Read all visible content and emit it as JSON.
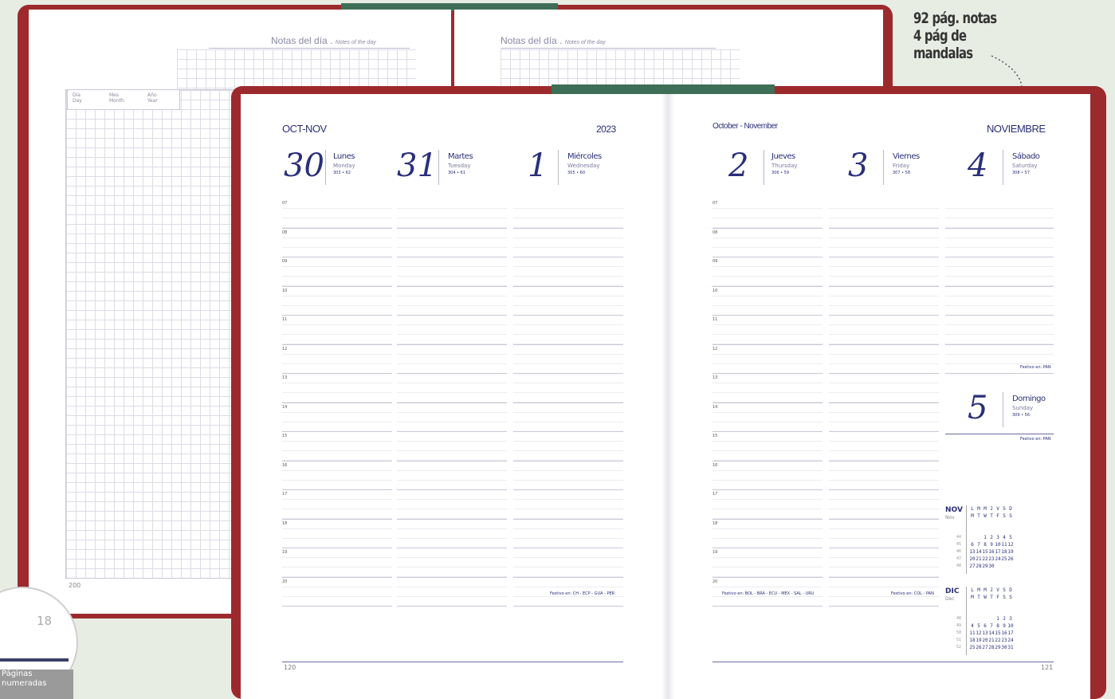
{
  "annotation": {
    "lines": [
      "92 pág. notas",
      "4 pág de",
      "mandalas"
    ]
  },
  "back_book": {
    "notes_title": "Notas del día .",
    "notes_subtitle": "Notes of the day",
    "date_fields": [
      "Día",
      "Mes",
      "Año"
    ],
    "date_fields_en": [
      "Day",
      "Month",
      "Year"
    ],
    "page_number": "200"
  },
  "badge": {
    "number": "18",
    "text_lines": [
      "Páginas",
      "numeradas"
    ]
  },
  "left_page": {
    "month_label": "OCT-NOV",
    "year": "2023",
    "days": [
      {
        "num": "30",
        "name": "Lunes",
        "eng": "Monday",
        "count": "303 • 62"
      },
      {
        "num": "31",
        "name": "Martes",
        "eng": "Tuesday",
        "count": "304 • 61"
      },
      {
        "num": "1",
        "name": "Miércoles",
        "eng": "Wednesday",
        "count": "305 • 60"
      }
    ],
    "hours": [
      "07",
      "08",
      "09",
      "10",
      "11",
      "12",
      "13",
      "14",
      "15",
      "16",
      "17",
      "18",
      "19",
      "20"
    ],
    "holidays": "Festivo en: CH - ECP - GUA - PER",
    "page_number": "120"
  },
  "right_page": {
    "month_label": "October - November",
    "month_title": "NOVIEMBRE",
    "days": [
      {
        "num": "2",
        "name": "Jueves",
        "eng": "Thursday",
        "count": "306 • 59"
      },
      {
        "num": "3",
        "name": "Viernes",
        "eng": "Friday",
        "count": "307 • 58"
      },
      {
        "num": "4",
        "name": "Sábado",
        "eng": "Saturday",
        "count": "308 • 57"
      }
    ],
    "sunday": {
      "num": "5",
      "name": "Domingo",
      "eng": "Sunday",
      "count": "309 • 56"
    },
    "hours": [
      "07",
      "08",
      "09",
      "10",
      "11",
      "12",
      "13",
      "14",
      "15",
      "16",
      "17",
      "18",
      "19",
      "20"
    ],
    "holiday_saturday": "Festivo en: PAN",
    "holiday_sunday": "Festivo en: PAN",
    "holidays_left": "Festivo en: BOL - BRA - ECU - MEX - SAL - URU",
    "holidays_right": "Festivo en: COL - PAN",
    "page_number": "121",
    "mini_cals": [
      {
        "month": "NOV",
        "month_en": "Nov",
        "head1": [
          "L",
          "M",
          "M",
          "J",
          "V",
          "S",
          "D"
        ],
        "head2": [
          "M",
          "T",
          "W",
          "T",
          "F",
          "S",
          "S"
        ],
        "rows": [
          [
            "",
            "",
            "1",
            "2",
            "3",
            "4",
            "5"
          ],
          [
            "6",
            "7",
            "8",
            "9",
            "10",
            "11",
            "12"
          ],
          [
            "13",
            "14",
            "15",
            "16",
            "17",
            "18",
            "19"
          ],
          [
            "20",
            "21",
            "22",
            "23",
            "24",
            "25",
            "26"
          ],
          [
            "27",
            "28",
            "29",
            "30",
            "",
            "",
            ""
          ]
        ],
        "weeks": [
          "44",
          "45",
          "46",
          "47",
          "48"
        ]
      },
      {
        "month": "DIC",
        "month_en": "Dec",
        "head1": [
          "L",
          "M",
          "M",
          "J",
          "V",
          "S",
          "D"
        ],
        "head2": [
          "M",
          "T",
          "W",
          "T",
          "F",
          "S",
          "S"
        ],
        "rows": [
          [
            "",
            "",
            "",
            "",
            "1",
            "2",
            "3"
          ],
          [
            "4",
            "5",
            "6",
            "7",
            "8",
            "9",
            "10"
          ],
          [
            "11",
            "12",
            "13",
            "14",
            "15",
            "16",
            "17"
          ],
          [
            "18",
            "19",
            "20",
            "21",
            "22",
            "23",
            "24"
          ],
          [
            "25",
            "26",
            "27",
            "28",
            "29",
            "30",
            "31"
          ]
        ],
        "weeks": [
          "48",
          "49",
          "50",
          "51",
          "52"
        ]
      }
    ]
  },
  "colors": {
    "cover": "#9c2a2d",
    "ribbon": "#3e6f56",
    "ink": "#2a2f7a"
  }
}
